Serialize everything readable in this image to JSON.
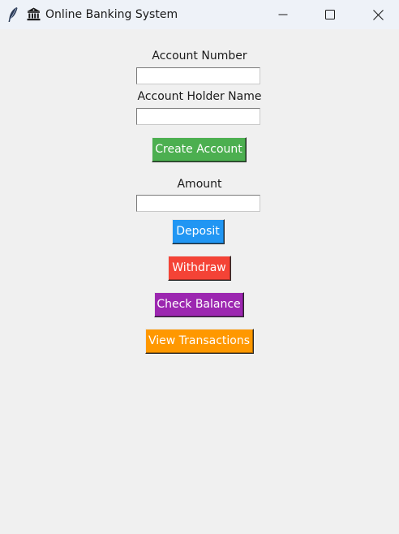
{
  "window": {
    "title": "Online Banking System",
    "title_icon": "bank-emoji-icon",
    "app_icon": "feather-icon",
    "controls": {
      "minimize_icon": "minimize-icon",
      "maximize_icon": "maximize-icon",
      "close_icon": "close-icon"
    }
  },
  "form": {
    "account_number_label": "Account Number",
    "account_number_value": "",
    "holder_name_label": "Account Holder Name",
    "holder_name_value": "",
    "create_account_label": "Create Account",
    "amount_label": "Amount",
    "amount_value": "",
    "deposit_label": "Deposit",
    "withdraw_label": "Withdraw",
    "check_balance_label": "Check Balance",
    "view_transactions_label": "View Transactions"
  },
  "colors": {
    "background": "#f0f0f0",
    "create_account": "#4caf50",
    "deposit": "#2196f3",
    "withdraw": "#f44336",
    "check_balance": "#9c27b0",
    "view_transactions": "#ff9800"
  }
}
